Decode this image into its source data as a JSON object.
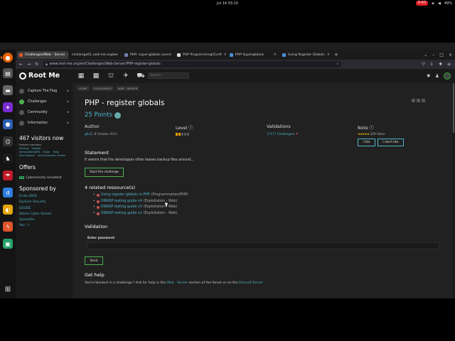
{
  "system": {
    "clock": "Jul 14  03:10",
    "rec_badge": "0:43",
    "battery": "49%"
  },
  "tabs": [
    {
      "label": "Challenges/Web - Server",
      "active": true
    },
    {
      "label": "challenge01.root-me.org/we",
      "active": false
    },
    {
      "label": "PHP: super-globals overvi",
      "active": false
    },
    {
      "label": "PHP Programming/Confi",
      "active": false
    },
    {
      "label": "PHP Superglobals",
      "active": false
    },
    {
      "label": "Using Register Globals",
      "active": false
    }
  ],
  "url": "www.root-me.org/en/Challenges/Web-Server/PHP-register-globals",
  "site": {
    "logo": "Root Me",
    "search_placeholder": "Search",
    "breadcrumb": [
      "HOME",
      "CHALLENGES",
      "WEB - SERVER"
    ],
    "nav": [
      "Capture The Flag",
      "Challenges",
      "Community",
      "Information"
    ],
    "visitors": "467 visitors now",
    "newest_label": "Newest members",
    "newest": [
      [
        "Im4hxg",
        "Illpleiar"
      ],
      [
        "Sarno4A6b3gPB",
        "Chbar",
        "Hegi"
      ],
      [
        "Mra Saweeo",
        "Abd Alcasimon Kroom"
      ]
    ],
    "offers_title": "Offers",
    "offer_badge": "ESI",
    "offer_text": "Cybersecurity consultant",
    "sponsor_title": "Sponsored by",
    "sponsors": [
      "École 2600",
      "Elysium Security",
      "GEODE",
      "Oteria Cyber School",
      "Synacktiv",
      "You ;-)"
    ]
  },
  "challenge": {
    "title": "PHP - register globals",
    "points": "25 Points",
    "author_head": "Author",
    "author_name": "g0uZ",
    "author_date": ", 8 October 2011",
    "level_head": "Level",
    "level": 2,
    "level_max": 5,
    "validations_head": "Validations",
    "validations_value": "17177 Challengers",
    "note_head": "Note",
    "stars": "★★★★★",
    "votes": "329 Votes",
    "like": "I like",
    "dislike": "I don't like",
    "statement_head": "Statement",
    "statement": "It seems that the developper often leaves backup files around...",
    "start_button": "Start the challenge",
    "resources_head": "4 related ressource(s)",
    "resources": [
      {
        "link": "Using register globals in PHP",
        "cat": " (Programmation/PHP)"
      },
      {
        "link": "OWASP testing guide v4",
        "cat": " (Exploitation - Web)"
      },
      {
        "link": "OWASP testing guide v3",
        "cat": " (Exploitation - Web)"
      },
      {
        "link": "OWASP testing guide v2",
        "cat": " (Exploitation - Web)"
      }
    ],
    "validation_head": "Validation",
    "password_label": "Enter password",
    "send": "Send",
    "help_head": "Get help",
    "help_pre": "You're blocked in a challenge ? Ask for help in the ",
    "help_link1": "Web - Server",
    "help_mid": " section of the forum or on the ",
    "help_link2": "Discord Server"
  }
}
